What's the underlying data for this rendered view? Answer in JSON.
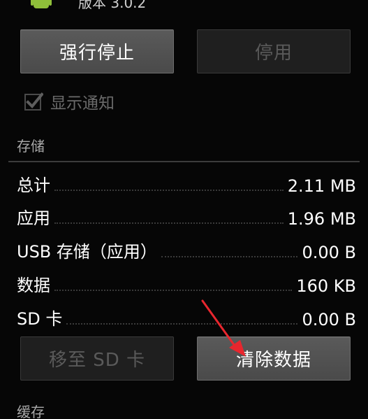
{
  "header": {
    "version_text": "版本 3.0.2"
  },
  "actions": {
    "force_stop_label": "强行停止",
    "disable_label": "停用"
  },
  "notifications": {
    "show_label": "显示通知",
    "checked": true
  },
  "storage": {
    "title": "存储",
    "rows": [
      {
        "label": "总计",
        "value": "2.11 MB"
      },
      {
        "label": "应用",
        "value": "1.96 MB"
      },
      {
        "label": "USB 存储（应用）",
        "value": "0.00 B"
      },
      {
        "label": "数据",
        "value": "160 KB"
      },
      {
        "label": "SD 卡",
        "value": "0.00 B"
      }
    ],
    "move_sd_label": "移至 SD 卡",
    "clear_data_label": "清除数据"
  },
  "cache": {
    "title": "缓存"
  },
  "colors": {
    "annotation_arrow": "#e8262e",
    "button_enabled": "#545454",
    "button_disabled": "#1f1f1f"
  }
}
